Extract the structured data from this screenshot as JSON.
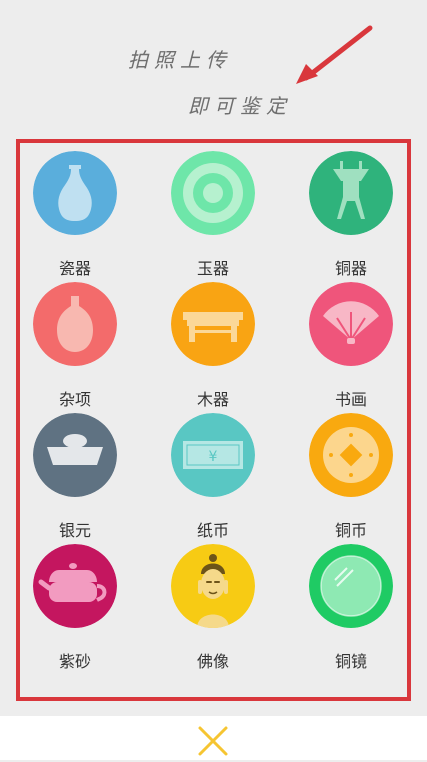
{
  "hint": {
    "line1": "拍照上传",
    "line2": "即可鉴定"
  },
  "categories": [
    {
      "label": "瓷器",
      "color": "#5aaedc",
      "icon": "vase-icon"
    },
    {
      "label": "玉器",
      "color": "#6ee6a9",
      "icon": "jade-disc-icon"
    },
    {
      "label": "铜器",
      "color": "#2fb37c",
      "icon": "bronze-vessel-icon"
    },
    {
      "label": "杂项",
      "color": "#f36b6b",
      "icon": "bottle-icon"
    },
    {
      "label": "木器",
      "color": "#f9a413",
      "icon": "wood-table-icon"
    },
    {
      "label": "书画",
      "color": "#ef557b",
      "icon": "fan-icon"
    },
    {
      "label": "银元",
      "color": "#5f7282",
      "icon": "silver-ingot-icon"
    },
    {
      "label": "纸币",
      "color": "#59c7c3",
      "icon": "banknote-icon"
    },
    {
      "label": "铜币",
      "color": "#f9a90f",
      "icon": "copper-coin-icon"
    },
    {
      "label": "紫砂",
      "color": "#c4165f",
      "icon": "teapot-icon"
    },
    {
      "label": "佛像",
      "color": "#f7cb14",
      "icon": "buddha-icon"
    },
    {
      "label": "铜镜",
      "color": "#1fcb64",
      "icon": "mirror-icon"
    }
  ],
  "colors": {
    "frame": "#d9373c",
    "arrow": "#d9373c",
    "close": "#f6c531",
    "background": "#ededed"
  },
  "close_icon": "close-icon"
}
